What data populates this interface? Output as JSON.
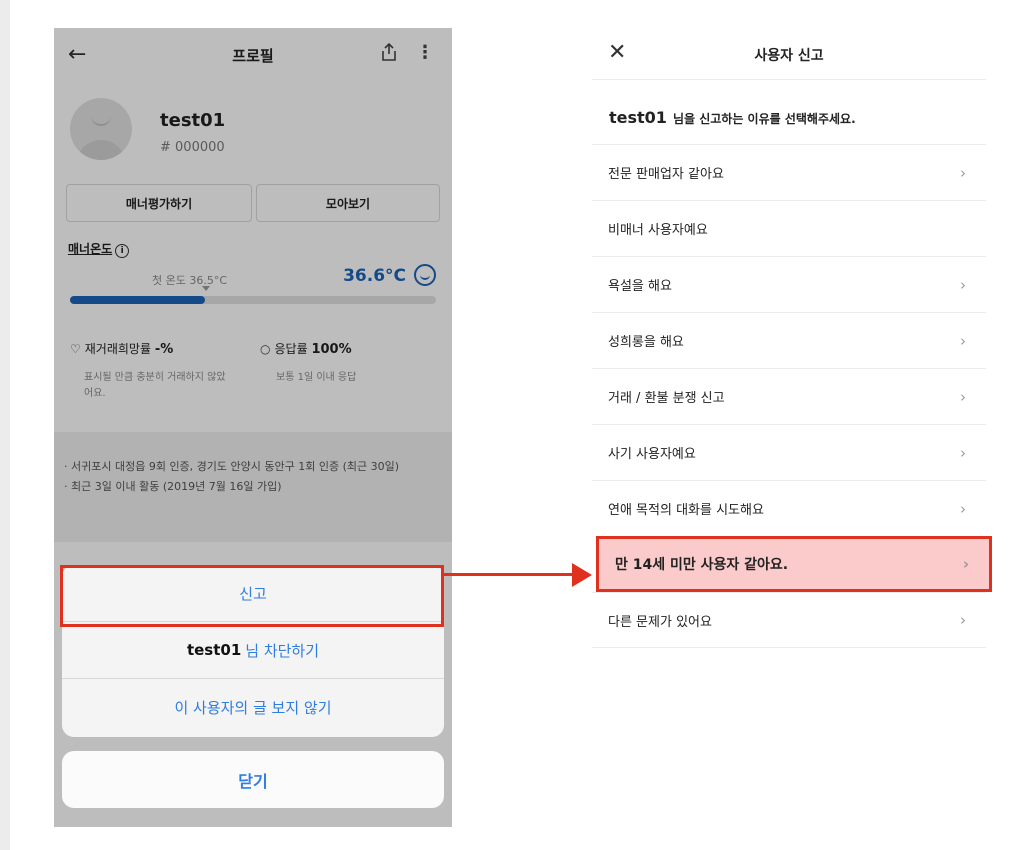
{
  "left_screen": {
    "title": "프로필",
    "nickname": "test01",
    "user_code": "# 000000",
    "buttons": {
      "manner_rating": "매너평가하기",
      "view_all": "모아보기"
    },
    "manner": {
      "label": "매너온도",
      "first_temp": "첫 온도 36.5°C",
      "value": "36.6°C",
      "fill_fraction": 0.37
    },
    "stats": {
      "rehire_label": "재거래희망률",
      "rehire_value": "-%",
      "rehire_desc": "표시될 만큼 충분히 거래하지 않았어요.",
      "response_label": "응답률",
      "response_value": "100%",
      "response_desc": "보통 1일 이내 응답"
    },
    "info": [
      "· 서귀포시 대정읍 9회 인증, 경기도 안양시 동안구 1회 인증 (최근 30일)",
      "· 최근 3일 이내 활동 (2019년 7월 16일 가입)"
    ],
    "action_sheet": {
      "report": "신고",
      "block_nick": "test01",
      "block_text": "님 차단하기",
      "hide_posts": "이 사용자의 글 보지 않기",
      "close": "닫기"
    }
  },
  "right_screen": {
    "title": "사용자 신고",
    "prompt_nick": "test01",
    "prompt_text": "님을 신고하는 이유를 선택해주세요.",
    "reasons": [
      {
        "label": "전문 판매업자 같아요",
        "chevron": true
      },
      {
        "label": "비매너 사용자예요",
        "chevron": false
      },
      {
        "label": "욕설을 해요",
        "chevron": true
      },
      {
        "label": "성희롱을 해요",
        "chevron": true
      },
      {
        "label": "거래 / 환불 분쟁 신고",
        "chevron": true
      },
      {
        "label": "사기 사용자예요",
        "chevron": true
      },
      {
        "label": "연애 목적의 대화를 시도해요",
        "chevron": true
      },
      {
        "label": "만 14세 미만 사용자 같아요.",
        "chevron": true,
        "selected": true
      },
      {
        "label": "다른 문제가 있어요",
        "chevron": true
      }
    ]
  },
  "colors": {
    "accent_blue": "#1d64b8",
    "ios_blue": "#2f7de1",
    "highlight_red": "#e0301e",
    "selected_bg": "#fbcaca"
  }
}
